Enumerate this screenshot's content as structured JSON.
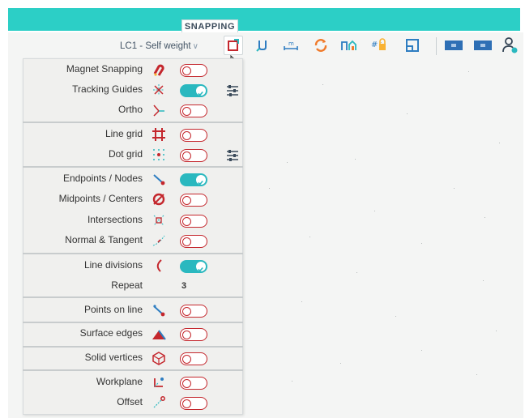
{
  "ribbon": {
    "tab_label": "SNAPPING"
  },
  "toolbar": {
    "load_case": "LC1 - Self weight",
    "icons": [
      "snapping-settings-icon",
      "dimension-icon",
      "measure-icon",
      "refresh-icon",
      "workplane-icon",
      "grid-lock-icon",
      "view-frame-icon",
      "display-mode-icon",
      "display-mode-2-icon",
      "user-settings-icon"
    ]
  },
  "snapping": {
    "items": [
      {
        "label": "Magnet Snapping",
        "icon": "magnet-icon",
        "state": "off"
      },
      {
        "label": "Tracking Guides",
        "icon": "tracking-guides-icon",
        "state": "on"
      },
      {
        "label": "Ortho",
        "icon": "ortho-icon",
        "state": "off"
      },
      {
        "label": "Line grid",
        "icon": "line-grid-icon",
        "state": "off"
      },
      {
        "label": "Dot grid",
        "icon": "dot-grid-icon",
        "state": "off"
      },
      {
        "label": "Endpoints / Nodes",
        "icon": "endpoint-icon",
        "state": "on"
      },
      {
        "label": "Midpoints / Centers",
        "icon": "midpoint-icon",
        "state": "off"
      },
      {
        "label": "Intersections",
        "icon": "intersection-icon",
        "state": "off"
      },
      {
        "label": "Normal & Tangent",
        "icon": "normal-tangent-icon",
        "state": "off"
      },
      {
        "label": "Line divisions",
        "icon": "line-divisions-icon",
        "state": "on"
      },
      {
        "label": "Repeat",
        "value": "3"
      },
      {
        "label": "Points on line",
        "icon": "points-on-line-icon",
        "state": "off"
      },
      {
        "label": "Surface edges",
        "icon": "surface-edges-icon",
        "state": "off"
      },
      {
        "label": "Solid vertices",
        "icon": "solid-vertices-icon",
        "state": "off"
      },
      {
        "label": "Workplane",
        "icon": "workplane-snap-icon",
        "state": "off"
      },
      {
        "label": "Offset",
        "icon": "offset-icon",
        "state": "off"
      }
    ]
  },
  "colors": {
    "accent": "#2ccfc6",
    "toggle_on": "#2ab8bf",
    "toggle_off": "#c4272d"
  }
}
